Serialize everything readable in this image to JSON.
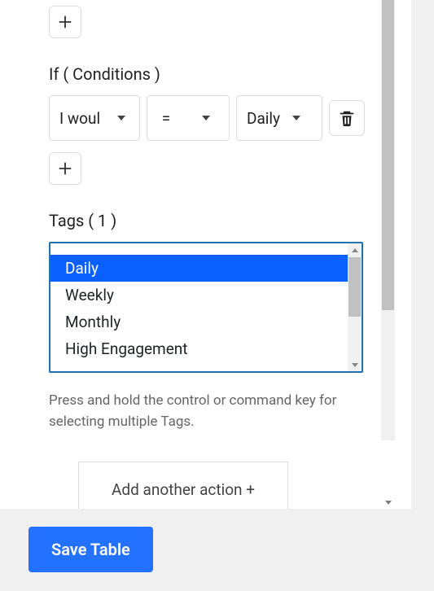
{
  "conditions": {
    "label": "If ( Conditions )",
    "field_value": "I woul",
    "operator_value": "=",
    "value_value": "Daily"
  },
  "tags": {
    "label": "Tags ( 1 )",
    "options": {
      "0": "Daily",
      "1": "Weekly",
      "2": "Monthly",
      "3": "High Engagement"
    },
    "help": "Press and hold the control or command key for selecting multiple Tags."
  },
  "actions": {
    "add_label": "Add another action +"
  },
  "save": {
    "label": "Save Table"
  }
}
